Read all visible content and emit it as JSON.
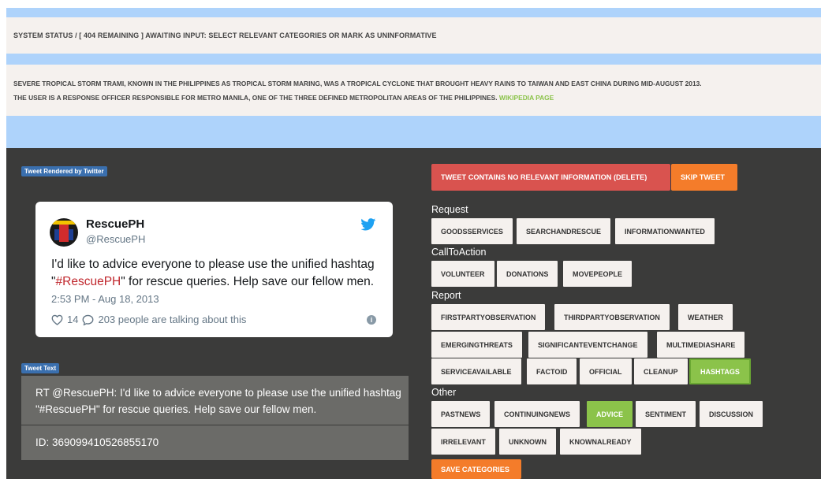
{
  "status_bar": {
    "text": "SYSTEM STATUS  /  [ 404 REMAINING ] AWAITING INPUT: SELECT RELEVANT CATEGORIES OR MARK AS UNINFORMATIVE"
  },
  "description": {
    "line1": "SEVERE TROPICAL STORM TRAMI, KNOWN IN THE PHILIPPINES AS TROPICAL STORM MARING, WAS A TROPICAL CYCLONE THAT BROUGHT HEAVY RAINS TO TAIWAN AND EAST CHINA DURING MID-AUGUST 2013.",
    "line2": "THE USER IS A RESPONSE OFFICER RESPONSIBLE FOR METRO MANILA, ONE OF THE THREE DEFINED METROPOLITAN AREAS OF THE PHILIPPINES. ",
    "wiki_link": "WIKIPEDIA PAGE"
  },
  "tweet_panel": {
    "rendered_label": "Tweet Rendered by Twitter",
    "name": "RescuePH",
    "handle": "@RescuePH",
    "text_before": "I'd like to advice everyone to please use the unified hashtag \"",
    "hashtag": "#RescuePH",
    "text_after": "\" for rescue queries. Help save our fellow men.",
    "date": "2:53 PM - Aug 18, 2013",
    "likes": "14",
    "talking": "203 people are talking about this",
    "text_label": "Tweet Text",
    "raw_text": "RT @RescuePH: I'd like to advice everyone to please use the unified hashtag \"#RescuePH\" for rescue queries. Help save our fellow men.",
    "id_text": "ID: 369099410526855170"
  },
  "actions": {
    "delete_label": "TWEET CONTAINS NO RELEVANT INFORMATION (DELETE)",
    "skip_label": "SKIP TWEET",
    "save_label": "SAVE CATEGORIES"
  },
  "groups": {
    "request": {
      "title": "Request",
      "items": [
        "GOODSSERVICES",
        "SEARCHANDRESCUE",
        "INFORMATIONWANTED"
      ]
    },
    "calltoaction": {
      "title": "CallToAction",
      "items": [
        "VOLUNTEER",
        "DONATIONS",
        "MOVEPEOPLE"
      ]
    },
    "report": {
      "title": "Report",
      "items": [
        "FIRSTPARTYOBSERVATION",
        "THIRDPARTYOBSERVATION",
        "WEATHER",
        "EMERGINGTHREATS",
        "SIGNIFICANTEVENTCHANGE",
        "MULTIMEDIASHARE",
        "SERVICEAVAILABLE",
        "FACTOID",
        "OFFICIAL",
        "CLEANUP",
        "HASHTAGS"
      ]
    },
    "other": {
      "title": "Other",
      "items": [
        "PASTNEWS",
        "CONTINUINGNEWS",
        "ADVICE",
        "SENTIMENT",
        "DISCUSSION",
        "IRRELEVANT",
        "UNKNOWN",
        "KNOWNALREADY"
      ]
    }
  },
  "selected": [
    "HASHTAGS",
    "ADVICE"
  ],
  "colors": {
    "band": "#aed3fb",
    "panel": "#3b3b3a",
    "selected": "#8bc34a",
    "danger": "#d9534f",
    "accent": "#f47c2a",
    "link": "#8bc34a"
  }
}
